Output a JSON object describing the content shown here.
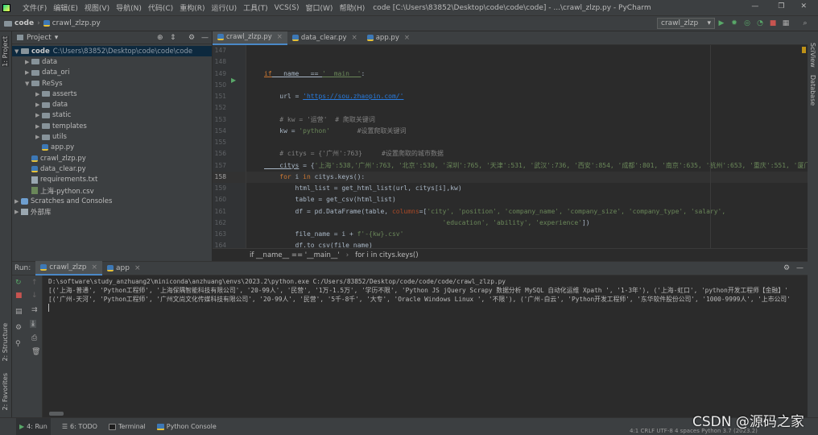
{
  "window": {
    "menus": [
      "文件(F)",
      "编辑(E)",
      "视图(V)",
      "导航(N)",
      "代码(C)",
      "重构(R)",
      "运行(U)",
      "工具(T)",
      "VCS(S)",
      "窗口(W)",
      "帮助(H)"
    ],
    "title": "code [C:\\Users\\83852\\Desktop\\code\\code\\code] - ...\\crawl_zlzp.py - PyCharm"
  },
  "nav": {
    "crumb_root": "code",
    "crumb_file": "crawl_zlzp.py",
    "run_config": "crawl_zlzp"
  },
  "left_strip": {
    "project": "1: Project",
    "structure": "2: Structure",
    "favorites": "2: Favorites"
  },
  "right_strip": {
    "sciview": "SciView",
    "database": "Database"
  },
  "project": {
    "header": "Project",
    "root_name": "code",
    "root_path": "C:\\Users\\83852\\Desktop\\code\\code\\code",
    "items": [
      {
        "label": "data",
        "kind": "folder",
        "level": 1
      },
      {
        "label": "data_ori",
        "kind": "folder",
        "level": 1
      },
      {
        "label": "ReSys",
        "kind": "folder",
        "level": 1,
        "open": true
      },
      {
        "label": "asserts",
        "kind": "folder",
        "level": 2
      },
      {
        "label": "data",
        "kind": "folder",
        "level": 2
      },
      {
        "label": "static",
        "kind": "folder",
        "level": 2
      },
      {
        "label": "templates",
        "kind": "folder",
        "level": 2
      },
      {
        "label": "utils",
        "kind": "folder",
        "level": 2
      },
      {
        "label": "app.py",
        "kind": "py",
        "level": 2
      },
      {
        "label": "crawl_zlzp.py",
        "kind": "py",
        "level": 1
      },
      {
        "label": "data_clear.py",
        "kind": "py",
        "level": 1
      },
      {
        "label": "requirements.txt",
        "kind": "txt",
        "level": 1
      },
      {
        "label": "上海-python.csv",
        "kind": "csv",
        "level": 1
      }
    ],
    "scratches": "Scratches and Consoles",
    "external": "外部库"
  },
  "editor": {
    "tabs": [
      "crawl_zlzp.py",
      "data_clear.py",
      "app.py"
    ],
    "line_numbers": [
      "147",
      "148",
      "149",
      "150",
      "151",
      "152",
      "153",
      "154",
      "155",
      "156",
      "157",
      "158",
      "159",
      "160",
      "161",
      "162",
      "163",
      "164"
    ],
    "current_line": "158",
    "code": {
      "l149_if": "if",
      "l149_name": " __name__ == ",
      "l149_main": "'__main__'",
      "l149_colon": ":",
      "l151_a": "    url = ",
      "l151_url": "'https://sou.zhaopin.com/'",
      "l153": "    # kw = '运营'  # 爬取关键词",
      "l154_a": "    kw = ",
      "l154_str": "'python'",
      "l154_cmt": "       #设置爬取关键词",
      "l156": "    # citys = {'广州':763}     #设置爬取的城市数据",
      "l157_a": "    citys",
      "l157_b": " = {",
      "l157_data": "'上海':538,'广州':763, '北京':530, '深圳':765, '天津':531, '武汉':736, '西安':854, '成都':801, '南京':635, '杭州':653, '重庆':551, '厦门':",
      "l158_for": "    for ",
      "l158_i": "i ",
      "l158_in": "in",
      "l158_rest": " citys.keys():",
      "l159": "        html_list = get_html_list(url, citys[i],kw)",
      "l160": "        table = get_csv(html_list)",
      "l161_a": "        df = pd.DataFrame(table, ",
      "l161_p": "columns",
      "l161_b": "=[",
      "l161_s": "'city', 'position', 'company_name', 'company_size', 'company_type', 'salary',",
      "l162_s": "                                              'education', 'ability', 'experience'",
      "l162_b": "])",
      "l163_a": "        file_name = i + ",
      "l163_s": "f'-{kw}.csv'",
      "l164": "        df.to_csv(file_name)"
    },
    "breadcrumb": [
      "if __name__ == '__main__'",
      "for i in citys.keys()"
    ]
  },
  "run": {
    "label": "Run:",
    "tabs": [
      "crawl_zlzp",
      "app"
    ],
    "console": [
      "D:\\software\\study_anzhuang2\\miniconda\\anzhuang\\envs\\2023.2\\python.exe C:/Users/83852/Desktop/code/code/code/crawl_zlzp.py",
      "[('上海-普通', 'Python工程师', '上海保隅智能科技有限公司', '20-99人', '民营', '1万-1.5万', '学历不限', 'Python JS jQuery Scrapy 数据分析 MySQL 自动化运维 Xpath ', '1-3年'), ('上海-虹口', 'python开发工程师【金融】'",
      "[('广州-天河', 'Python工程师', '广州文尚文化传媒科技有限公司', '20-99人', '民营', '5千-8千', '大专', 'Oracle Windows Linux ', '不限'), ('广州-白云', 'Python开发工程师', '东华软件股份公司', '1000-9999人', '上市公司'"
    ]
  },
  "bottom": {
    "tabs": [
      "4: Run",
      "6: TODO",
      "Terminal",
      "Python Console"
    ],
    "watermark": "CSDN @源码之家",
    "status": "4:1  CRLF  UTF-8  4 spaces  Python 3.7 (2023.2)"
  }
}
